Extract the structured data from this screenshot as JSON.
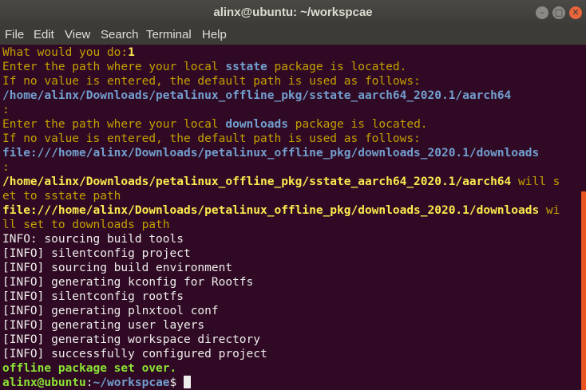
{
  "window": {
    "title": "alinx@ubuntu: ~/workspcae"
  },
  "menu": [
    "File",
    "Edit",
    "View",
    "Search",
    "Terminal",
    "Help"
  ],
  "lines": {
    "l1a": "What would you do:",
    "l1b": "1",
    "l2a": "Enter the path where your local ",
    "l2b": "sstate",
    "l2c": " package is located.",
    "l3": "If no value is entered, the default path is used as follows:",
    "l4": "/home/alinx/Downloads/petalinux_offline_pkg/sstate_aarch64_2020.1/aarch64",
    "l5": ":",
    "l6a": "Enter the path where your local ",
    "l6b": "downloads",
    "l6c": " package is located.",
    "l7": "If no value is entered, the default path is used as follows:",
    "l8": "file:///home/alinx/Downloads/petalinux_offline_pkg/downloads_2020.1/downloads",
    "l9": ":",
    "l10a": "/home/alinx/Downloads/petalinux_offline_pkg/sstate_aarch64_2020.1/aarch64",
    "l10b": " will s",
    "l11": "et to sstate path",
    "l12a": "file:///home/alinx/Downloads/petalinux_offline_pkg/downloads_2020.1/downloads",
    "l12b": " wi",
    "l13": "ll set to downloads path",
    "l14": "INFO: sourcing build tools",
    "l15": "[INFO] silentconfig project",
    "l16": "[INFO] sourcing build environment",
    "l17": "[INFO] generating kconfig for Rootfs",
    "l18": "[INFO] silentconfig rootfs",
    "l19": "[INFO] generating plnxtool conf",
    "l20": "[INFO] generating user layers",
    "l21": "[INFO] generating workspace directory",
    "l22": "[INFO] successfully configured project",
    "l23": "offline package set over.",
    "prompt_user": "alinx@ubuntu",
    "prompt_colon": ":",
    "prompt_path": "~/workspcae",
    "prompt_sign": "$ "
  },
  "colors": {
    "background": "#300a24",
    "titlebar": "#3c3b37",
    "close": "#e9653b",
    "scrollbar": "#e95420"
  }
}
